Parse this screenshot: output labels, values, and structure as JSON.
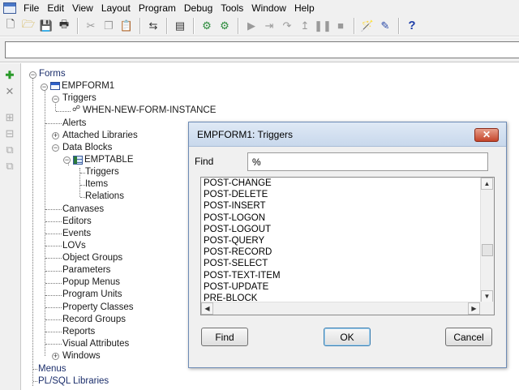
{
  "menubar": {
    "items": [
      "File",
      "Edit",
      "View",
      "Layout",
      "Program",
      "Debug",
      "Tools",
      "Window",
      "Help"
    ]
  },
  "toolbar": {
    "icons": [
      "new-icon",
      "open-icon",
      "save-icon",
      "print-icon",
      "cut-icon",
      "copy-icon",
      "paste-icon",
      "connect-icon",
      "compile-icon",
      "run-form-icon",
      "debug-icon",
      "step-into-icon",
      "step-over-icon",
      "step-out-icon",
      "pause-icon",
      "stop-icon",
      "wizard-icon",
      "property-icon",
      "help-icon"
    ],
    "help_label": "?"
  },
  "tree": {
    "root": "Forms",
    "form": "EMPFORM1",
    "triggers": "Triggers",
    "trigger_item": "WHEN-NEW-FORM-INSTANCE",
    "alerts": "Alerts",
    "attached_libraries": "Attached Libraries",
    "data_blocks": "Data Blocks",
    "emptable": "EMPTABLE",
    "block_triggers": "Triggers",
    "block_items": "Items",
    "block_relations": "Relations",
    "canvases": "Canvases",
    "editors": "Editors",
    "events": "Events",
    "lovs": "LOVs",
    "object_groups": "Object Groups",
    "parameters": "Parameters",
    "popup_menus": "Popup Menus",
    "program_units": "Program Units",
    "property_classes": "Property Classes",
    "record_groups": "Record Groups",
    "reports": "Reports",
    "visual_attributes": "Visual Attributes",
    "windows": "Windows",
    "menus": "Menus",
    "plsql_libraries": "PL/SQL Libraries"
  },
  "dialog": {
    "title": "EMPFORM1: Triggers",
    "close_label": "✕",
    "find_label": "Find",
    "find_value": "%",
    "list": [
      "POST-CHANGE",
      "POST-DELETE",
      "POST-INSERT",
      "POST-LOGON",
      "POST-LOGOUT",
      "POST-QUERY",
      "POST-RECORD",
      "POST-SELECT",
      "POST-TEXT-ITEM",
      "POST-UPDATE",
      "PRE-BLOCK"
    ],
    "buttons": {
      "find": "Find",
      "ok": "OK",
      "cancel": "Cancel"
    }
  }
}
